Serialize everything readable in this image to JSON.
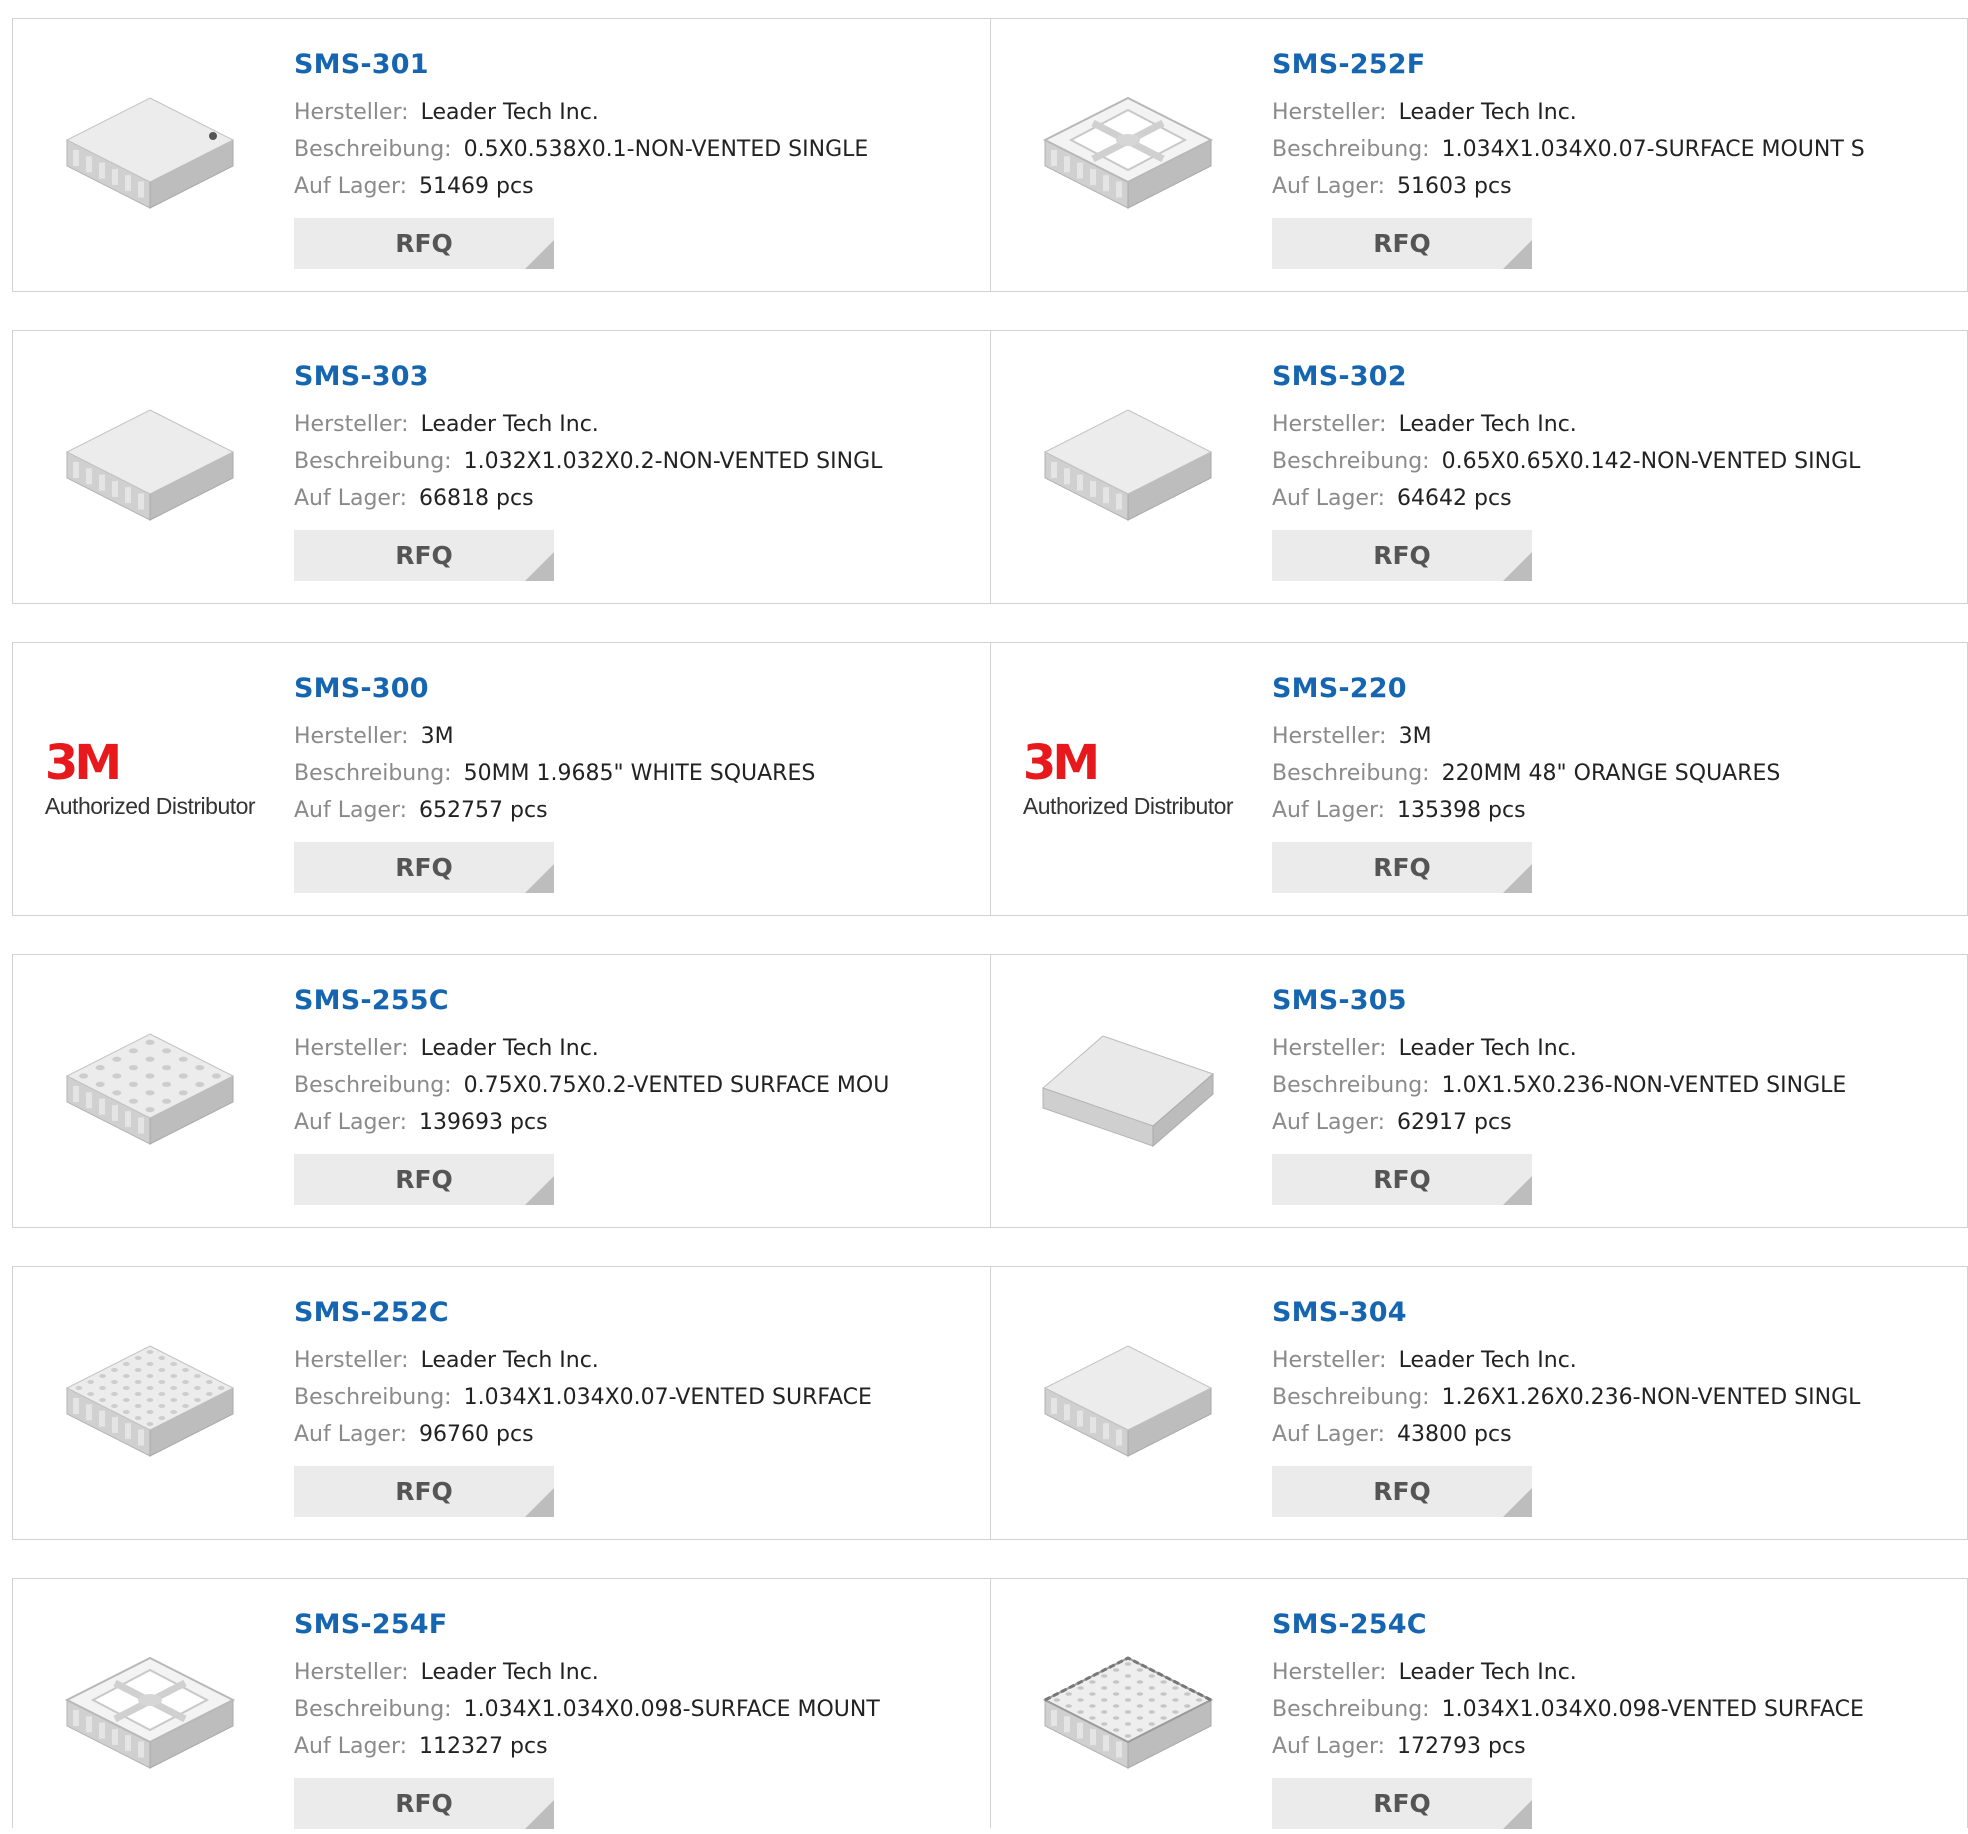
{
  "labels": {
    "manufacturer": "Hersteller:",
    "description": "Beschreibung:",
    "stock": "Auf Lager:",
    "rfq": "RFQ"
  },
  "colors": {
    "part_number": "#1565b0",
    "label": "#8a8a8a",
    "button_bg": "#ebebeb",
    "brand_red": "#e8191c"
  },
  "products": [
    {
      "part": "SMS-301",
      "manufacturer": "Leader Tech Inc.",
      "description": "0.5X0.538X0.1-NON-VENTED SINGLE",
      "stock": "51469 pcs",
      "image": "solid-shield-small"
    },
    {
      "part": "SMS-252F",
      "manufacturer": "Leader Tech Inc.",
      "description": "1.034X1.034X0.07-SURFACE MOUNT S",
      "stock": "51603 pcs",
      "image": "frame-shield"
    },
    {
      "part": "SMS-303",
      "manufacturer": "Leader Tech Inc.",
      "description": "1.032X1.032X0.2-NON-VENTED SINGL",
      "stock": "66818 pcs",
      "image": "solid-shield"
    },
    {
      "part": "SMS-302",
      "manufacturer": "Leader Tech Inc.",
      "description": "0.65X0.65X0.142-NON-VENTED SINGL",
      "stock": "64642 pcs",
      "image": "solid-shield"
    },
    {
      "part": "SMS-300",
      "manufacturer": "3M",
      "description": "50MM 1.9685\" WHITE SQUARES",
      "stock": "652757 pcs",
      "image": "3m-logo",
      "logo_text": "3M",
      "logo_caption": "Authorized Distributor"
    },
    {
      "part": "SMS-220",
      "manufacturer": "3M",
      "description": "220MM 48\" ORANGE SQUARES",
      "stock": "135398 pcs",
      "image": "3m-logo",
      "logo_text": "3M",
      "logo_caption": "Authorized Distributor"
    },
    {
      "part": "SMS-255C",
      "manufacturer": "Leader Tech Inc.",
      "description": "0.75X0.75X0.2-VENTED SURFACE MOU",
      "stock": "139693 pcs",
      "image": "vented-shield"
    },
    {
      "part": "SMS-305",
      "manufacturer": "Leader Tech Inc.",
      "description": "1.0X1.5X0.236-NON-VENTED SINGLE",
      "stock": "62917 pcs",
      "image": "solid-shield-rect"
    },
    {
      "part": "SMS-252C",
      "manufacturer": "Leader Tech Inc.",
      "description": "1.034X1.034X0.07-VENTED SURFACE",
      "stock": "96760 pcs",
      "image": "vented-shield-dense"
    },
    {
      "part": "SMS-304",
      "manufacturer": "Leader Tech Inc.",
      "description": "1.26X1.26X0.236-NON-VENTED SINGL",
      "stock": "43800 pcs",
      "image": "solid-shield"
    },
    {
      "part": "SMS-254F",
      "manufacturer": "Leader Tech Inc.",
      "description": "1.034X1.034X0.098-SURFACE MOUNT",
      "stock": "112327 pcs",
      "image": "frame-shield"
    },
    {
      "part": "SMS-254C",
      "manufacturer": "Leader Tech Inc.",
      "description": "1.034X1.034X0.098-VENTED SURFACE",
      "stock": "172793 pcs",
      "image": "cover-shield"
    }
  ]
}
